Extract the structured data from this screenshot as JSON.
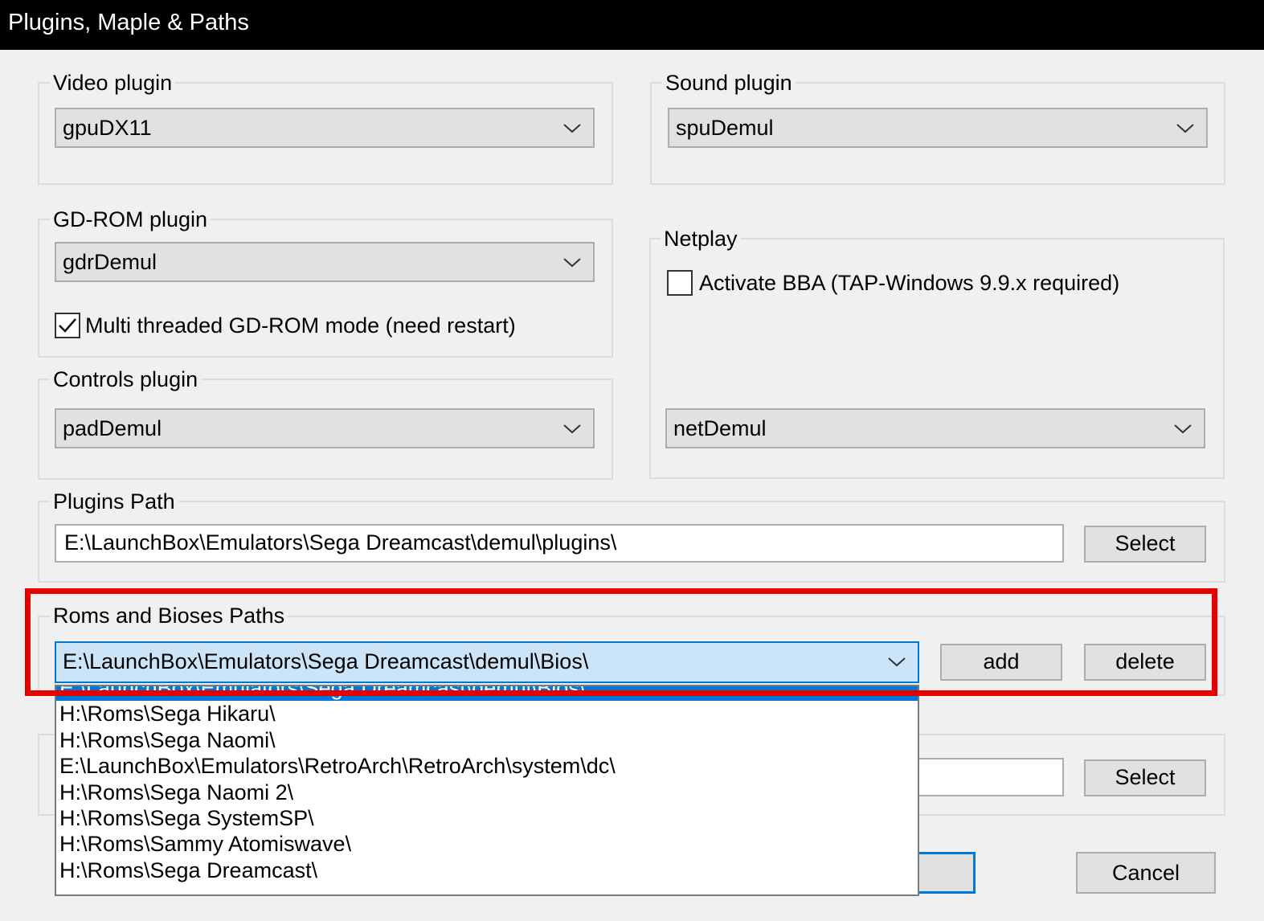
{
  "window": {
    "title": "Plugins, Maple & Paths"
  },
  "video": {
    "legend": "Video plugin",
    "value": "gpuDX11"
  },
  "sound": {
    "legend": "Sound plugin",
    "value": "spuDemul"
  },
  "gdrom": {
    "legend": "GD-ROM plugin",
    "value": "gdrDemul",
    "multithread_label": "Multi threaded GD-ROM mode (need restart)",
    "multithread_checked": true
  },
  "netplay": {
    "legend": "Netplay",
    "bba_label": "Activate BBA (TAP-Windows 9.9.x required)",
    "bba_checked": false,
    "value": "netDemul"
  },
  "controls": {
    "legend": "Controls plugin",
    "value": "padDemul"
  },
  "plugins_path": {
    "legend": "Plugins Path",
    "value": "E:\\LaunchBox\\Emulators\\Sega Dreamcast\\demul\\plugins\\",
    "select_label": "Select"
  },
  "roms": {
    "legend": "Roms and Bioses Paths",
    "value": "E:\\LaunchBox\\Emulators\\Sega Dreamcast\\demul\\Bios\\",
    "add_label": "add",
    "delete_label": "delete",
    "options": [
      "E:\\LaunchBox\\Emulators\\Sega Dreamcast\\demul\\Bios\\",
      "H:\\Roms\\Sega Hikaru\\",
      "H:\\Roms\\Sega Naomi\\",
      "E:\\LaunchBox\\Emulators\\RetroArch\\RetroArch\\system\\dc\\",
      "H:\\Roms\\Sega Naomi 2\\",
      "H:\\Roms\\Sega SystemSP\\",
      "H:\\Roms\\Sammy Atomiswave\\",
      "H:\\Roms\\Sega Dreamcast\\"
    ],
    "selected_index": 0
  },
  "lower_path": {
    "select_label": "Select"
  },
  "dialog": {
    "cancel_label": "Cancel"
  },
  "colors": {
    "highlight": "#e60000",
    "selection": "#0078d7",
    "focus_border": "#0078d7"
  }
}
